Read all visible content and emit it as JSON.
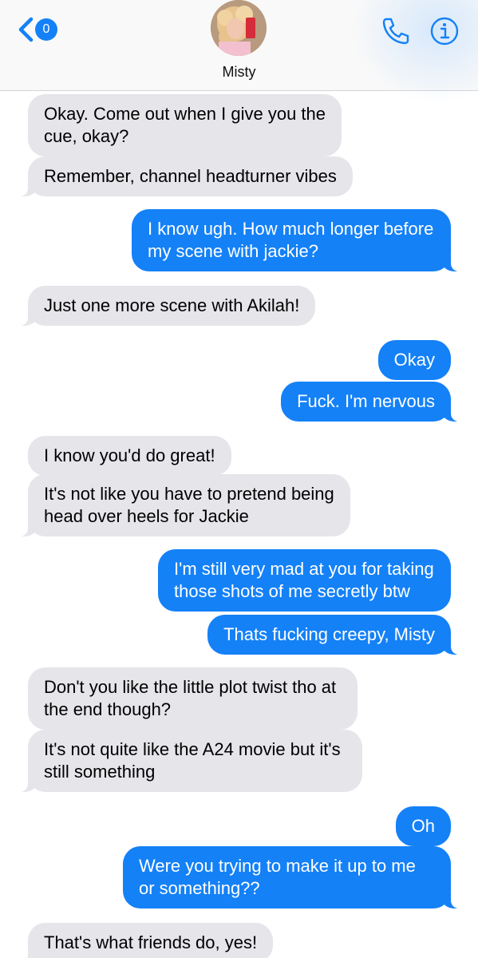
{
  "header": {
    "back_badge": "0",
    "contact_name": "Misty",
    "accent_color": "#1481f7"
  },
  "icons": {
    "back": "chevron-left-icon",
    "call": "phone-icon",
    "info": "info-icon"
  },
  "messages": [
    {
      "from": "them",
      "text": "Okay. Come out when I give you the cue, okay?"
    },
    {
      "from": "them",
      "text": "Remember, channel headturner vibes"
    },
    {
      "from": "me",
      "text": "I know ugh. How much longer before my scene with jackie?"
    },
    {
      "from": "them",
      "text": "Just one more scene with Akilah!"
    },
    {
      "from": "me",
      "text": "Okay"
    },
    {
      "from": "me",
      "text": "Fuck. I'm nervous"
    },
    {
      "from": "them",
      "text": "I know you'd do great!"
    },
    {
      "from": "them",
      "text": "It's not like you have to pretend being head over heels for Jackie"
    },
    {
      "from": "me",
      "text": "I'm still very mad at you for taking those shots of me secretly btw"
    },
    {
      "from": "me",
      "text": "Thats fucking creepy, Misty"
    },
    {
      "from": "them",
      "text": "Don't you like the little plot twist tho at the end though?"
    },
    {
      "from": "them",
      "text": "It's not quite like the A24 movie but it's still something"
    },
    {
      "from": "me",
      "text": "Oh"
    },
    {
      "from": "me",
      "text": "Were you trying to make it up to me or something??"
    },
    {
      "from": "them",
      "text": "That's what friends do, yes!"
    }
  ]
}
